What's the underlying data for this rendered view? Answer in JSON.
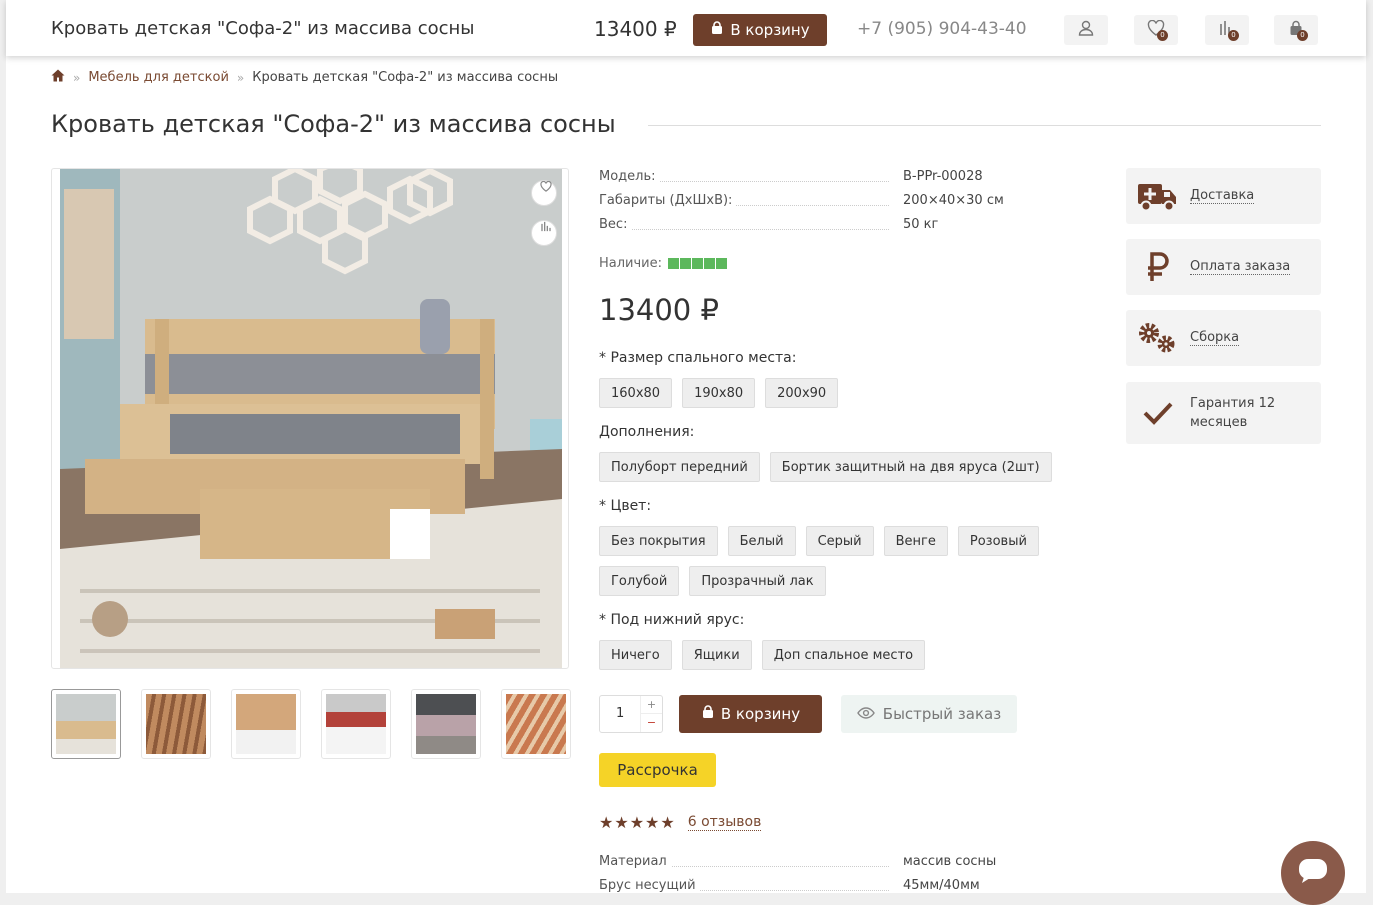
{
  "header": {
    "title": "Кровать детская \"Софа-2\" из массива сосны",
    "price": "13400 ₽",
    "cart_label": "В корзину",
    "phone": "+7 (905) 904-43-40",
    "wishlist_count": "0",
    "compare_count": "0",
    "cart_count": "0"
  },
  "breadcrumbs": {
    "category": "Мебель для детской",
    "current": "Кровать детская \"Софа-2\" из массива сосны"
  },
  "product": {
    "title": "Кровать детская \"Софа-2\" из массива сосны",
    "specs": [
      {
        "key": "Модель:",
        "value": "B-PPr-00028"
      },
      {
        "key": "Габариты (ДхШхВ):",
        "value": "200×40×30 см"
      },
      {
        "key": "Вес:",
        "value": "50 кг"
      }
    ],
    "availability_label": "Наличие:",
    "availability_level": 5,
    "price": "13400 ₽",
    "option_groups": [
      {
        "label": "* Размер спального места:",
        "options": [
          "160x80",
          "190x80",
          "200x90"
        ]
      },
      {
        "label": "Дополнения:",
        "options": [
          "Полуборт передний",
          "Бортик защитный на двя яруса (2шт)"
        ]
      },
      {
        "label": "* Цвет:",
        "options": [
          "Без покрытия",
          "Белый",
          "Серый",
          "Венге",
          "Розовый",
          "Голубой",
          "Прозрачный лак"
        ]
      },
      {
        "label": "* Под нижний ярус:",
        "options": [
          "Ничего",
          "Ящики",
          "Доп спальное место"
        ]
      }
    ],
    "quantity": "1",
    "qty_plus": "+",
    "qty_minus": "−",
    "buy_label": "В корзину",
    "quick_order_label": "Быстрый заказ",
    "installment_label": "Рассрочка",
    "rating_stars": "★★★★★",
    "reviews_label": "6 отзывов",
    "attributes": [
      {
        "key": "Материал",
        "value": "массив сосны"
      },
      {
        "key": "Брус несущий",
        "value": "45мм/40мм"
      }
    ]
  },
  "info_boxes": [
    {
      "label": "Доставка",
      "icon": "delivery-truck-icon"
    },
    {
      "label": "Оплата заказа",
      "icon": "ruble-icon"
    },
    {
      "label": "Сборка",
      "icon": "gears-icon"
    },
    {
      "label": "Гарантия 12 месяцев",
      "icon": "checkmark-icon"
    }
  ],
  "colors": {
    "brand": "#6e3f2b",
    "stock": "#5cb85c",
    "installment": "#f5d327"
  }
}
